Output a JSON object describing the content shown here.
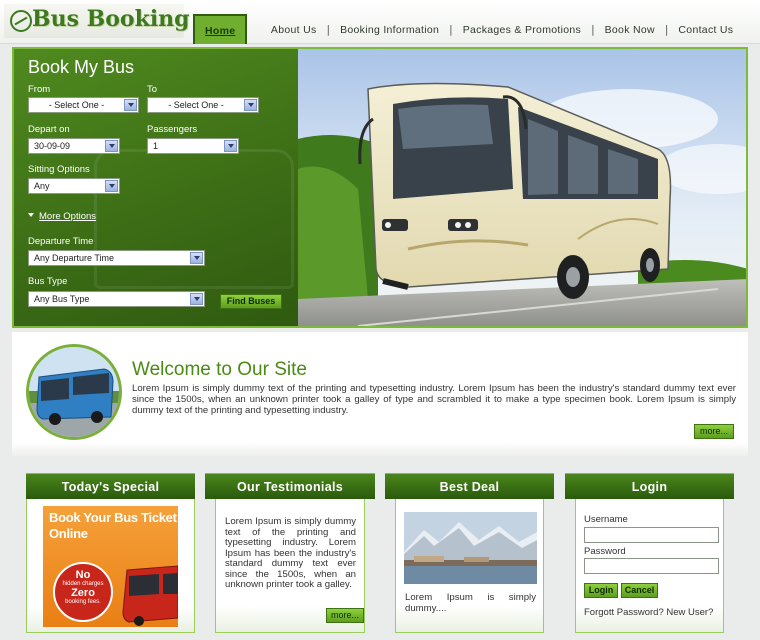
{
  "brand": {
    "logo_text": "Bus Booking"
  },
  "nav": {
    "items": [
      "Home",
      "About Us",
      "Booking Information",
      "Packages & Promotions",
      "Book Now",
      "Contact Us"
    ],
    "separator": "|",
    "active": "Home"
  },
  "booking_form": {
    "title": "Book My Bus",
    "from": {
      "label": "From",
      "value": "- Select One -"
    },
    "to": {
      "label": "To",
      "value": "- Select One -"
    },
    "depart_on": {
      "label": "Depart on",
      "value": "30-09-09"
    },
    "passengers": {
      "label": "Passengers",
      "value": "1"
    },
    "sitting": {
      "label": "Sitting Options",
      "value": "Any"
    },
    "more_options": "More Options",
    "departure_time": {
      "label": "Departure Time",
      "value": "Any Departure Time"
    },
    "bus_type": {
      "label": "Bus Type",
      "value": "Any Bus Type"
    },
    "submit": "Find Buses"
  },
  "welcome": {
    "title": "Welcome to Our Site",
    "text": "Lorem Ipsum is simply dummy text of the printing and typesetting industry. Lorem Ipsum has been the industry's standard dummy text ever since the 1500s, when an unknown printer took a galley of type and scrambled it to make a type specimen book. Lorem Ipsum is simply dummy text of the printing and typesetting industry.",
    "more": "more..."
  },
  "special": {
    "title": "Today's Special",
    "ad_headline": "Book Your Bus Ticket Online",
    "ad_no": "No",
    "ad_hidden": "hidden charges",
    "ad_zero": "Zero",
    "ad_fees": "booking fees."
  },
  "testimonials": {
    "title": "Our Testimonials",
    "text": "Lorem Ipsum is simply dummy text of the printing and typesetting industry. Lorem Ipsum has been the industry's standard dummy text ever since the 1500s, when an unknown printer took a galley.",
    "more": "more..."
  },
  "best_deal": {
    "title": "Best Deal",
    "text": "Lorem Ipsum is simply dummy...."
  },
  "login": {
    "title": "Login",
    "username_label": "Username",
    "password_label": "Password",
    "login_button": "Login",
    "cancel_button": "Cancel",
    "links": "Forgott Password? New User?"
  },
  "colors": {
    "accent": "#4a8a14",
    "panel": "#3d6e16",
    "button": "#7cc02e"
  }
}
